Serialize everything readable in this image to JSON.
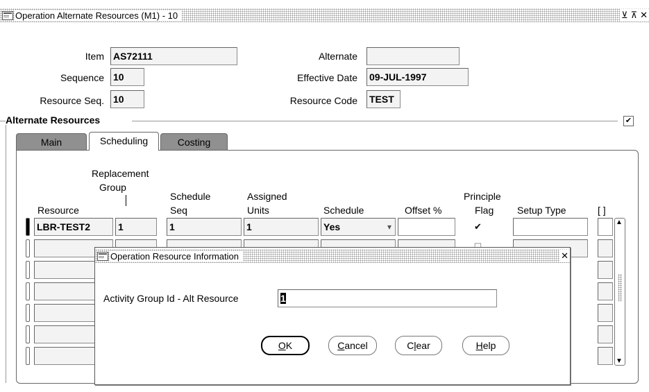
{
  "window": {
    "title": "Operation Alternate Resources (M1) - 10",
    "btn_minimize": "⊻",
    "btn_maximize": "⊼",
    "btn_close": "✕"
  },
  "form": {
    "item_label": "Item",
    "item_value": "AS72111",
    "sequence_label": "Sequence",
    "sequence_value": "10",
    "resource_seq_label": "Resource Seq.",
    "resource_seq_value": "10",
    "alternate_label": "Alternate",
    "alternate_value": "",
    "effective_date_label": "Effective Date",
    "effective_date_value": "09-JUL-1997",
    "resource_code_label": "Resource Code",
    "resource_code_value": "TEST"
  },
  "section": {
    "title": "Alternate Resources",
    "checkbox_mark": "✔"
  },
  "tabs": [
    {
      "label": "Main"
    },
    {
      "label": "Scheduling"
    },
    {
      "label": "Costing"
    }
  ],
  "table": {
    "headers": {
      "resource": "Resource",
      "replacement_group_1": "Replacement",
      "replacement_group_2": "Group",
      "schedule_seq_1": "Schedule",
      "schedule_seq_2": "Seq",
      "assigned_units_1": "Assigned",
      "assigned_units_2": "Units",
      "schedule": "Schedule",
      "offset": "Offset %",
      "principle_flag_1": "Principle",
      "principle_flag_2": "Flag",
      "setup_type": "Setup Type",
      "extra": "[ ]"
    },
    "row1": {
      "resource": "LBR-TEST2",
      "replacement_group": "1",
      "schedule_seq": "1",
      "assigned_units": "1",
      "schedule": "Yes",
      "offset": "",
      "principle_flag": "✔",
      "setup_type": ""
    },
    "schedule_dropdown_arrow": "▾",
    "principle_flag_empty": "☐"
  },
  "dialog": {
    "title": "Operation Resource Information",
    "close": "✕",
    "field_label": "Activity Group Id - Alt Resource",
    "field_value": "1",
    "buttons": {
      "ok": {
        "mnemonic": "O",
        "rest": "K"
      },
      "cancel": {
        "mnemonic": "C",
        "rest": "ancel"
      },
      "clear": {
        "pre": "C",
        "mnemonic": "l",
        "rest": "ear"
      },
      "help": {
        "mnemonic": "H",
        "rest": "elp"
      }
    }
  },
  "scrollbar": {
    "up": "▲",
    "down": "▼"
  }
}
